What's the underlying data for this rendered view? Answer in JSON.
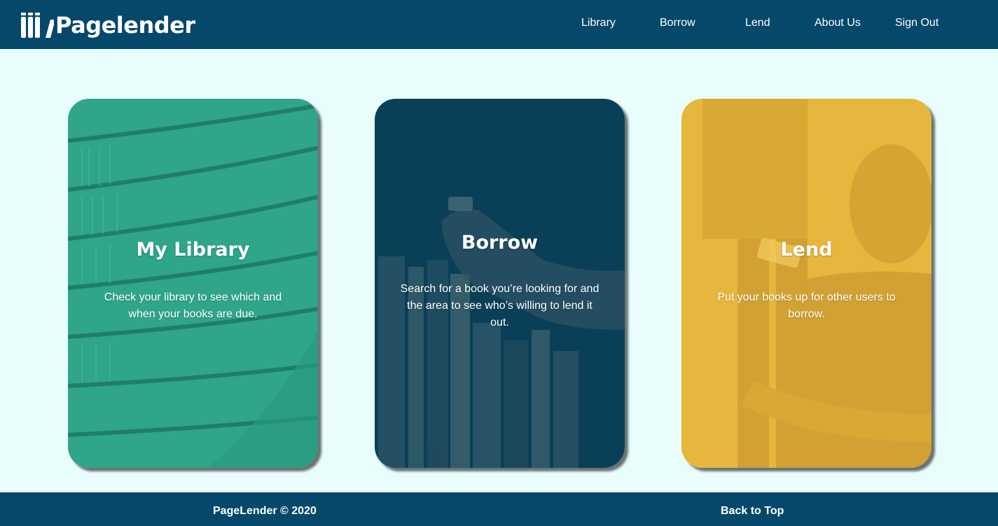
{
  "header": {
    "logo_text": "Pagelender",
    "nav": [
      {
        "label": "Library"
      },
      {
        "label": "Borrow"
      },
      {
        "label": "Lend"
      },
      {
        "label": "About Us"
      },
      {
        "label": "Sign Out"
      }
    ]
  },
  "cards": [
    {
      "title": "My Library",
      "description": "Check your library to see which and when your books are due.",
      "overlay_color": "#2fa58a"
    },
    {
      "title": "Borrow",
      "description": "Search for a book you’re looking for and the area to see who’s willing to lend it out.",
      "overlay_color": "#0a3f58"
    },
    {
      "title": "Lend",
      "description": "Put your books up for other users to borrow.",
      "overlay_color": "#e6b73c"
    }
  ],
  "footer": {
    "copyright": "PageLender © 2020",
    "back_to_top": "Back to Top"
  },
  "colors": {
    "header_bg": "#05486a",
    "page_bg": "#e9fdfd"
  }
}
